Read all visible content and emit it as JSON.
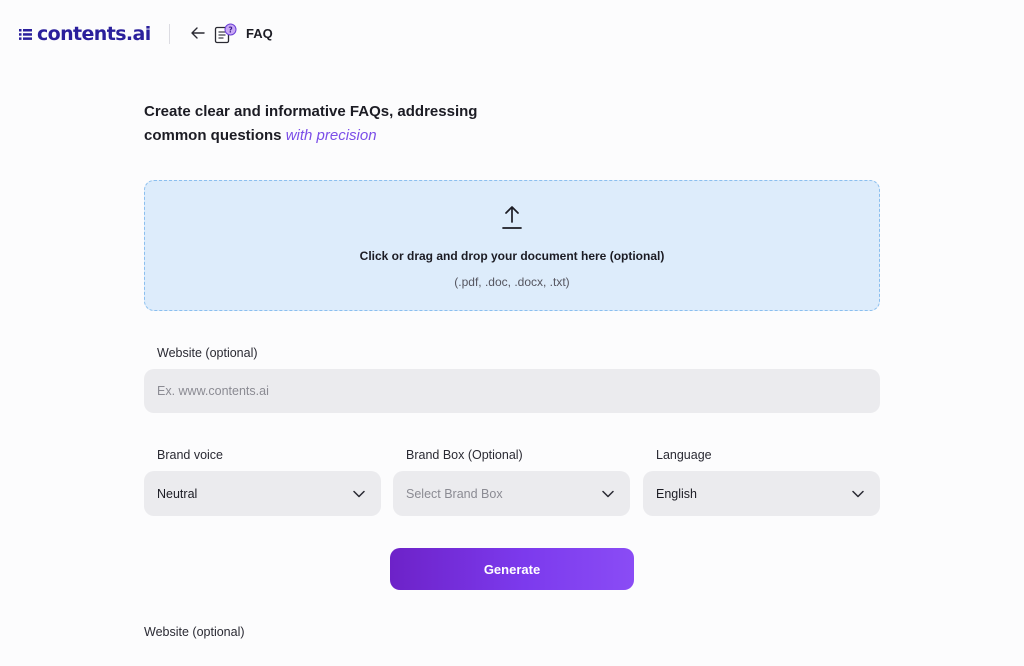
{
  "app": {
    "logo_text": "contents.ai",
    "page_label": "FAQ",
    "brand_color": "#2a1f9c"
  },
  "heading": {
    "line1": "Create clear and informative FAQs, addressing",
    "line2_plain": "common questions ",
    "line2_accent": "with precision",
    "accent_color": "#7b4ee8"
  },
  "dropzone": {
    "title": "Click or drag and drop your document here (optional)",
    "formats": "(.pdf, .doc, .docx, .txt)",
    "icon": "upload-icon"
  },
  "website": {
    "label": "Website (optional)",
    "placeholder": "Ex. www.contents.ai",
    "value": ""
  },
  "selects": {
    "brand_voice": {
      "label": "Brand voice",
      "value": "Neutral"
    },
    "brand_box": {
      "label": "Brand Box (Optional)",
      "placeholder": "Select Brand Box"
    },
    "language": {
      "label": "Language",
      "value": "English"
    }
  },
  "generate": {
    "label": "Generate",
    "color": "#7c3aed"
  },
  "footer_section": {
    "label": "Website (optional)"
  },
  "icons": [
    "list-logo-icon",
    "back-arrow-icon",
    "faq-document-icon",
    "upload-icon",
    "chevron-down-icon"
  ]
}
